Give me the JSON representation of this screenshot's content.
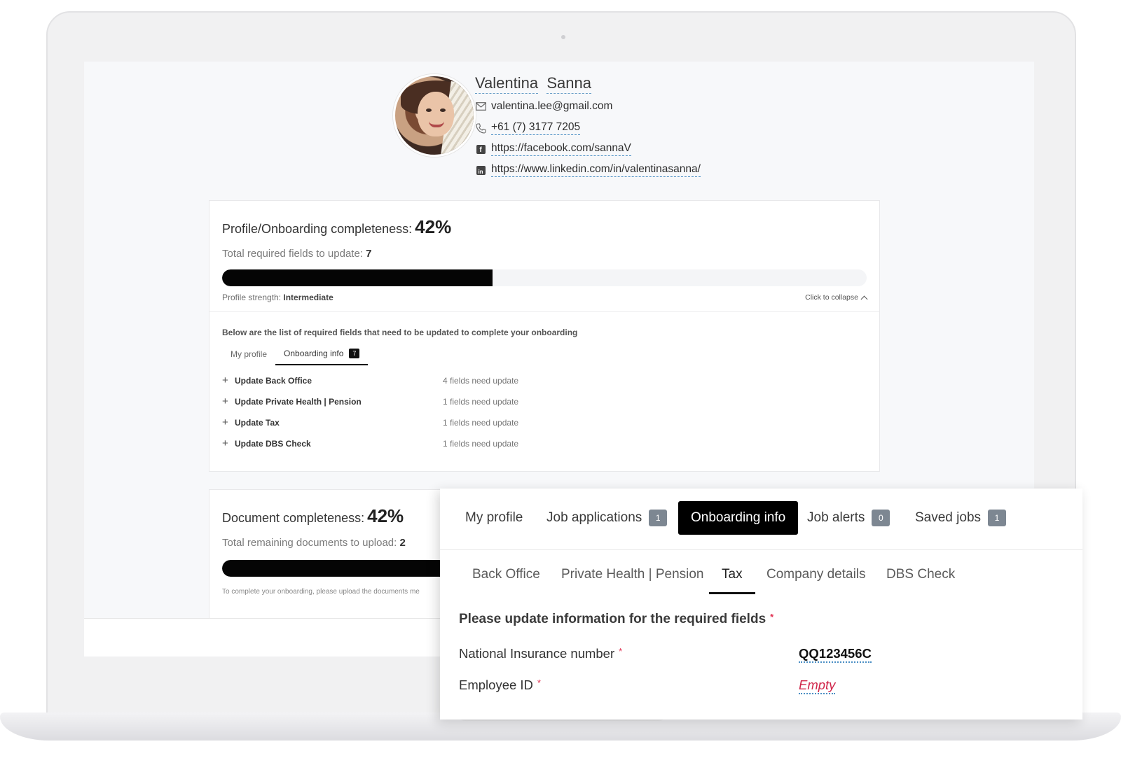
{
  "profile": {
    "first_name": "Valentina",
    "last_name": "Sanna",
    "email": "valentina.lee@gmail.com",
    "phone": "+61 (7) 3177 7205",
    "facebook": "https://facebook.com/sannaV",
    "linkedin": "https://www.linkedin.com/in/valentinasanna/"
  },
  "completeness": {
    "title": "Profile/Onboarding completeness:",
    "percent_label": "42%",
    "percent_value": 0.42,
    "required_label": "Total required fields to update:",
    "required_count": "7",
    "strength_label": "Profile strength:",
    "strength_value": "Intermediate",
    "collapse_label": "Click to collapse",
    "below_text": "Below are the list of required fields that need to be updated to complete your onboarding",
    "tabs": [
      {
        "label": "My profile"
      },
      {
        "label": "Onboarding info",
        "badge": "7"
      }
    ],
    "items": [
      {
        "label": "Update Back Office",
        "count": "4 fields need update"
      },
      {
        "label": "Update Private Health | Pension",
        "count": "1 fields need update"
      },
      {
        "label": "Update Tax",
        "count": "1 fields need update"
      },
      {
        "label": "Update DBS Check",
        "count": "1 fields need update"
      }
    ]
  },
  "documents": {
    "title": "Document completeness:",
    "percent_label": "42%",
    "percent_value": 0.42,
    "remaining_label": "Total remaining documents to upload:",
    "remaining_count": "2",
    "note": "To complete your onboarding, please upload the documents me"
  },
  "overlay": {
    "main_tabs": [
      {
        "label": "My profile"
      },
      {
        "label": "Job applications",
        "badge": "1"
      },
      {
        "label": "Onboarding info"
      },
      {
        "label": "Job alerts",
        "badge": "0"
      },
      {
        "label": "Saved jobs",
        "badge": "1"
      }
    ],
    "sub_tabs": [
      {
        "label": "Back Office"
      },
      {
        "label": "Private Health | Pension"
      },
      {
        "label": "Tax"
      },
      {
        "label": "Company details"
      },
      {
        "label": "DBS Check"
      }
    ],
    "heading": "Please update information for the required fields",
    "required_mark": "*",
    "fields": [
      {
        "label": "National Insurance number",
        "value": "QQ123456C"
      },
      {
        "label": "Employee ID",
        "value": "Empty"
      }
    ]
  }
}
